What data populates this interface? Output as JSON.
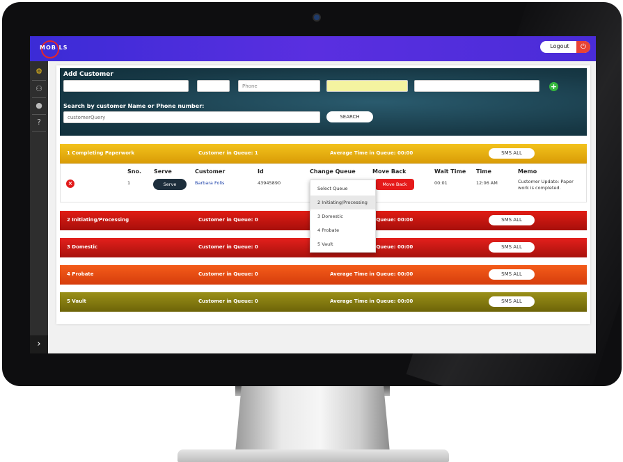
{
  "app": {
    "logo_text": "MOB LS",
    "logout_label": "Logout"
  },
  "sidebar": {
    "items": [
      "gear-icon",
      "users-icon",
      "info-icon",
      "help-icon"
    ]
  },
  "add_customer": {
    "title": "Add Customer",
    "phone_placeholder": "Phone",
    "search_label": "Search by customer Name or Phone number:",
    "search_value": "customerQuery",
    "search_button": "SEARCH"
  },
  "queues": [
    {
      "name": "1 Completing Paperwork",
      "count": "Customer in Queue: 1",
      "avg": "Average Time in Queue: 00:00",
      "sms": "SMS ALL"
    },
    {
      "name": "2 Initiating/Processing",
      "count": "Customer in Queue: 0",
      "avg": "Average Time in Queue: 00:00",
      "sms": "SMS ALL"
    },
    {
      "name": "3 Domestic",
      "count": "Customer in Queue: 0",
      "avg": "Average Time in Queue: 00:00",
      "sms": "SMS ALL"
    },
    {
      "name": "4 Probate",
      "count": "Customer in Queue: 0",
      "avg": "Average Time in Queue: 00:00",
      "sms": "SMS ALL"
    },
    {
      "name": "5 Vault",
      "count": "Customer in Queue: 0",
      "avg": "Average Time in Queue: 00:00",
      "sms": "SMS ALL"
    }
  ],
  "table": {
    "headers": [
      "Sno.",
      "Serve",
      "Customer",
      "Id",
      "Change Queue",
      "Move Back",
      "Wait Time",
      "Time",
      "Memo"
    ],
    "row": {
      "sno": "1",
      "serve": "Serve",
      "customer": "Barbara Folis",
      "id": "43945890",
      "move_back": "Move Back",
      "wait_time": "00:01",
      "time": "12:06 AM",
      "memo": "Customer Update: Paper work is completed."
    }
  },
  "dropdown": {
    "options": [
      "Select Queue",
      "2 Initiating/Processing",
      "3 Domestic",
      "4 Probate",
      "5 Vault"
    ],
    "highlighted": "2 Initiating/Processing"
  }
}
